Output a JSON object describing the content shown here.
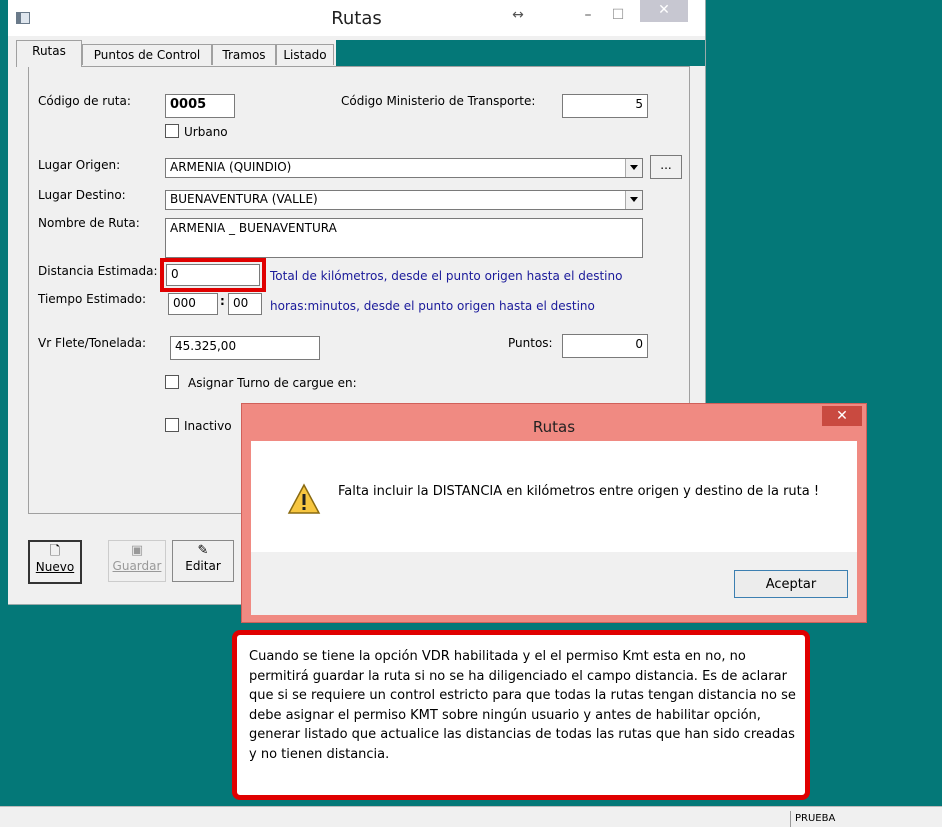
{
  "window": {
    "title": "Rutas",
    "resize_glyph": "↔",
    "minimize_glyph": "–",
    "maximize_glyph": "☐",
    "close_glyph": "✕"
  },
  "tabs": [
    {
      "label": "Rutas",
      "active": true
    },
    {
      "label": "Puntos de Control",
      "active": false
    },
    {
      "label": "Tramos",
      "active": false
    },
    {
      "label": "Listado",
      "active": false
    }
  ],
  "form": {
    "codigo_ruta_label": "Código de ruta:",
    "codigo_ruta_value": "0005",
    "urbano_label": "Urbano",
    "codigo_ministerio_label": "Código Ministerio de Transporte:",
    "codigo_ministerio_value": "5",
    "lugar_origen_label": "Lugar Origen:",
    "lugar_origen_value": "ARMENIA  (QUINDIO)",
    "browse_label": "...",
    "lugar_destino_label": "Lugar Destino:",
    "lugar_destino_value": "BUENAVENTURA  (VALLE)",
    "nombre_ruta_label": "Nombre de Ruta:",
    "nombre_ruta_value": "ARMENIA _ BUENAVENTURA",
    "distancia_label": "Distancia Estimada:",
    "distancia_value": "0",
    "distancia_hint": "Total de kilómetros, desde el punto origen hasta el destino",
    "tiempo_label": "Tiempo Estimado:",
    "tiempo_horas": "000",
    "tiempo_minutos": "00",
    "tiempo_hint": "horas:minutos, desde el punto origen hasta el destino",
    "flete_label": "Vr Flete/Tonelada:",
    "flete_value": "45.325,00",
    "puntos_label": "Puntos:",
    "puntos_value": "0",
    "asignar_turno_label": "Asignar Turno de cargue en:",
    "inactivo_label": "Inactivo"
  },
  "toolbar": {
    "nuevo_label": "Nuevo",
    "guardar_label": "Guardar",
    "editar_label": "Editar"
  },
  "dialog": {
    "title": "Rutas",
    "close_glyph": "✕",
    "message": "Falta incluir la DISTANCIA en kilómetros entre origen y destino de la ruta !",
    "ok_label": "Aceptar"
  },
  "callout": {
    "text": "Cuando se tiene la opción VDR habilitada y el el permiso Kmt esta en no, no permitirá guardar la ruta si no se ha diligenciado el campo distancia. Es de aclarar que si se requiere un control estricto para que todas la rutas tengan distancia no se debe asignar el permiso KMT sobre ningún usuario y antes de habilitar opción, generar listado que actualice las distancias de todas las rutas que han sido creadas y no tienen distancia."
  },
  "status": {
    "pane_text": "PRUEBA"
  },
  "colors": {
    "desktop": "#047878",
    "dialog_frame": "#f08a82",
    "highlight_red": "#e00000",
    "hint_blue": "#1a1a9a"
  }
}
